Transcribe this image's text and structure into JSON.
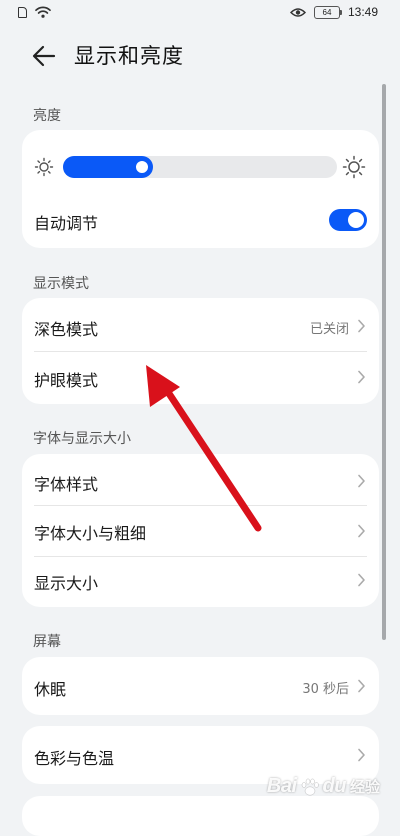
{
  "status_bar": {
    "time": "13:49",
    "battery": "64"
  },
  "header": {
    "title": "显示和亮度"
  },
  "brightness": {
    "section_label": "亮度",
    "level": 0.33,
    "auto_label": "自动调节",
    "auto_enabled": true
  },
  "display_mode": {
    "section_label": "显示模式",
    "items": [
      {
        "label": "深色模式",
        "value": "已关闭"
      },
      {
        "label": "护眼模式",
        "value": ""
      }
    ]
  },
  "font_display": {
    "section_label": "字体与显示大小",
    "items": [
      {
        "label": "字体样式"
      },
      {
        "label": "字体大小与粗细"
      },
      {
        "label": "显示大小"
      }
    ]
  },
  "screen": {
    "section_label": "屏幕",
    "items": [
      {
        "label": "休眠",
        "value": "30 秒后"
      }
    ]
  },
  "color": {
    "items": [
      {
        "label": "色彩与色温"
      }
    ]
  },
  "watermark": {
    "latin": "Bai",
    "latin_suffix": "du",
    "chinese": "经验"
  },
  "colors": {
    "accent": "#0a59f7",
    "background": "#f1f3f5",
    "card": "#ffffff",
    "annotation_arrow": "#d9111b"
  }
}
